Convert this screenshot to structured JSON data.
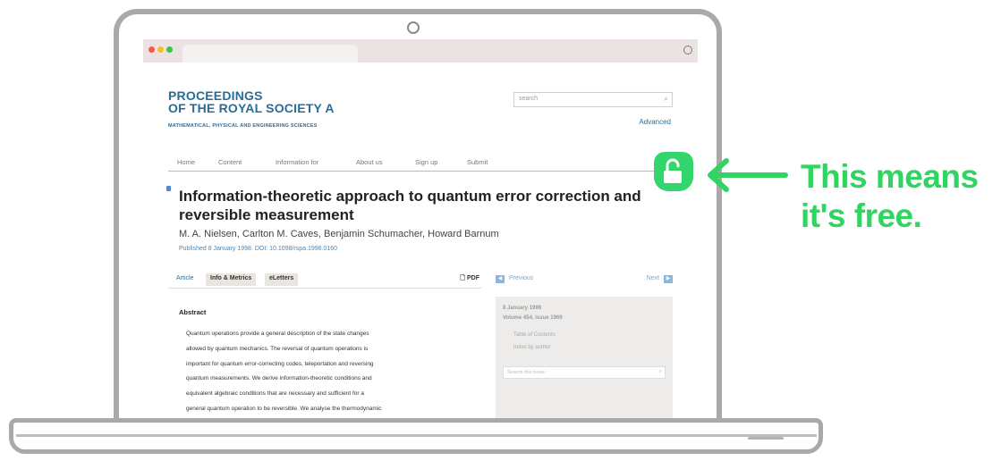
{
  "journal": {
    "name_line1": "PROCEEDINGS",
    "name_line2": "OF THE ROYAL SOCIETY A",
    "subtitle": "MATHEMATICAL, PHYSICAL AND ENGINEERING SCIENCES"
  },
  "search": {
    "placeholder": "search",
    "advanced_link": "Advanced"
  },
  "nav": [
    "Home",
    "Content",
    "Information for",
    "About us",
    "Sign up",
    "Submit"
  ],
  "article": {
    "title": "Information-theoretic approach to quantum error correction and reversible measurement",
    "authors": "M. A. Nielsen, Carlton M. Caves, Benjamin Schumacher, Howard Barnum",
    "published": "Published 8 January 1998. DOI: 10.1098/rspa.1998.0160"
  },
  "tabs": [
    "Article",
    "Info & Metrics",
    "eLetters"
  ],
  "pdf_label": "PDF",
  "abstract": {
    "heading": "Abstract",
    "lines": [
      "Quantum operations provide a general description of the state changes",
      "allowed by quantum mechanics. The reversal of quantum operations is",
      "important for quantum error-correcting codes, teleportation and reversing",
      "quantum measurements. We derive information-theoretic conditions and",
      "equivalent algebraic conditions that are necessary and sufficient for a",
      "general quantum operation to be reversible. We analyse the thermodynamic"
    ]
  },
  "sidebar": {
    "previous": "Previous",
    "next": "Next",
    "issue_date": "8 January 1998",
    "issue_volume": "Volume 454, issue 1969",
    "toc": "Table of Contents",
    "index": "Index by author",
    "search_placeholder": "Search this issue"
  },
  "annotation": {
    "line1": "This means",
    "line2": "it's free.",
    "color": "#2fd461",
    "icon": "unlocked-padlock-icon"
  }
}
